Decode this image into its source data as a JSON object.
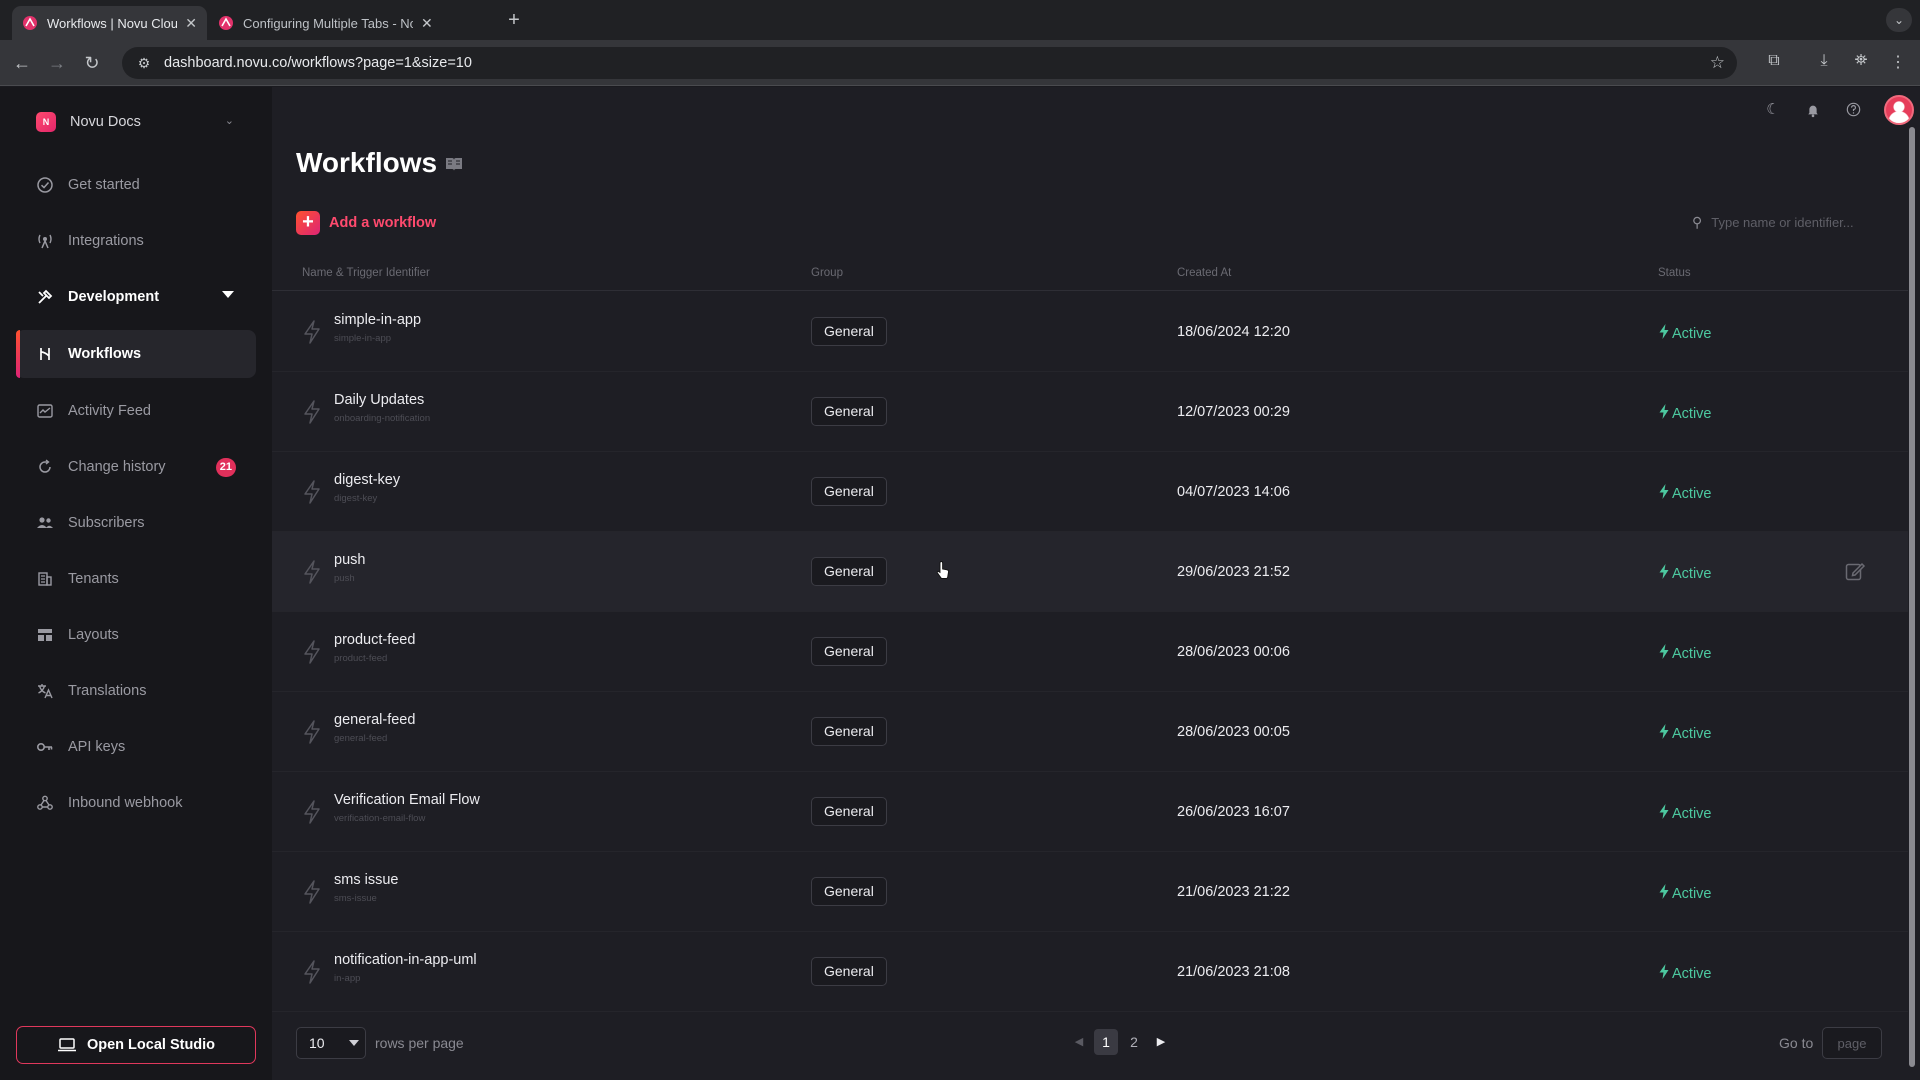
{
  "browser": {
    "tabs": [
      {
        "title": "Workflows | Novu Cloud Dashboard",
        "active": true
      },
      {
        "title": "Configuring Multiple Tabs - Novu",
        "active": false
      }
    ],
    "new_tab": "+",
    "url": "dashboard.novu.co/workflows?page=1&size=10"
  },
  "sidebar": {
    "org_initial": "N",
    "org_name": "Novu Docs",
    "items": [
      {
        "label": "Get started",
        "icon": "check-circle-icon"
      },
      {
        "label": "Integrations",
        "icon": "broadcast-icon"
      },
      {
        "label": "Development",
        "icon": "tools-icon",
        "section": true
      },
      {
        "label": "Workflows",
        "icon": "workflow-icon",
        "selected": true
      },
      {
        "label": "Activity Feed",
        "icon": "activity-icon"
      },
      {
        "label": "Change history",
        "icon": "history-icon",
        "badge": "21"
      },
      {
        "label": "Subscribers",
        "icon": "users-icon"
      },
      {
        "label": "Tenants",
        "icon": "building-icon"
      },
      {
        "label": "Layouts",
        "icon": "layout-icon"
      },
      {
        "label": "Translations",
        "icon": "translate-icon"
      },
      {
        "label": "API keys",
        "icon": "key-icon"
      },
      {
        "label": "Inbound webhook",
        "icon": "webhook-icon"
      }
    ],
    "open_local_studio": "Open Local Studio"
  },
  "header": {
    "icons": [
      "moon-icon",
      "bell-icon",
      "help-icon",
      "avatar"
    ]
  },
  "main": {
    "title": "Workflows",
    "add_workflow": "Add a workflow",
    "search_placeholder": "Type name or identifier...",
    "columns": [
      "Name & Trigger Identifier",
      "Group",
      "Created At",
      "Status"
    ],
    "rows": [
      {
        "name": "simple-in-app",
        "identifier": "simple-in-app",
        "group": "General",
        "created": "18/06/2024 12:20",
        "status": "Active"
      },
      {
        "name": "Daily Updates",
        "identifier": "onboarding-notification",
        "group": "General",
        "created": "12/07/2023 00:29",
        "status": "Active"
      },
      {
        "name": "digest-key",
        "identifier": "digest-key",
        "group": "General",
        "created": "04/07/2023 14:06",
        "status": "Active"
      },
      {
        "name": "push",
        "identifier": "push",
        "group": "General",
        "created": "29/06/2023 21:52",
        "status": "Active",
        "hovered": true
      },
      {
        "name": "product-feed",
        "identifier": "product-feed",
        "group": "General",
        "created": "28/06/2023 00:06",
        "status": "Active"
      },
      {
        "name": "general-feed",
        "identifier": "general-feed",
        "group": "General",
        "created": "28/06/2023 00:05",
        "status": "Active"
      },
      {
        "name": "Verification Email Flow",
        "identifier": "verification-email-flow",
        "group": "General",
        "created": "26/06/2023 16:07",
        "status": "Active"
      },
      {
        "name": "sms issue",
        "identifier": "sms-issue",
        "group": "General",
        "created": "21/06/2023 21:22",
        "status": "Active"
      },
      {
        "name": "notification-in-app-uml",
        "identifier": "in-app",
        "group": "General",
        "created": "21/06/2023 21:08",
        "status": "Active"
      }
    ],
    "pagination": {
      "rows_per_page_value": "10",
      "rows_per_page_label": "rows per page",
      "pages": [
        "1",
        "2"
      ],
      "current_page": "1",
      "goto_label": "Go to",
      "goto_placeholder": "page"
    }
  },
  "colors": {
    "accent": "#dd2476",
    "active_status": "#4dc9a0",
    "background": "#1e1e24",
    "sidebar": "#17171b"
  }
}
